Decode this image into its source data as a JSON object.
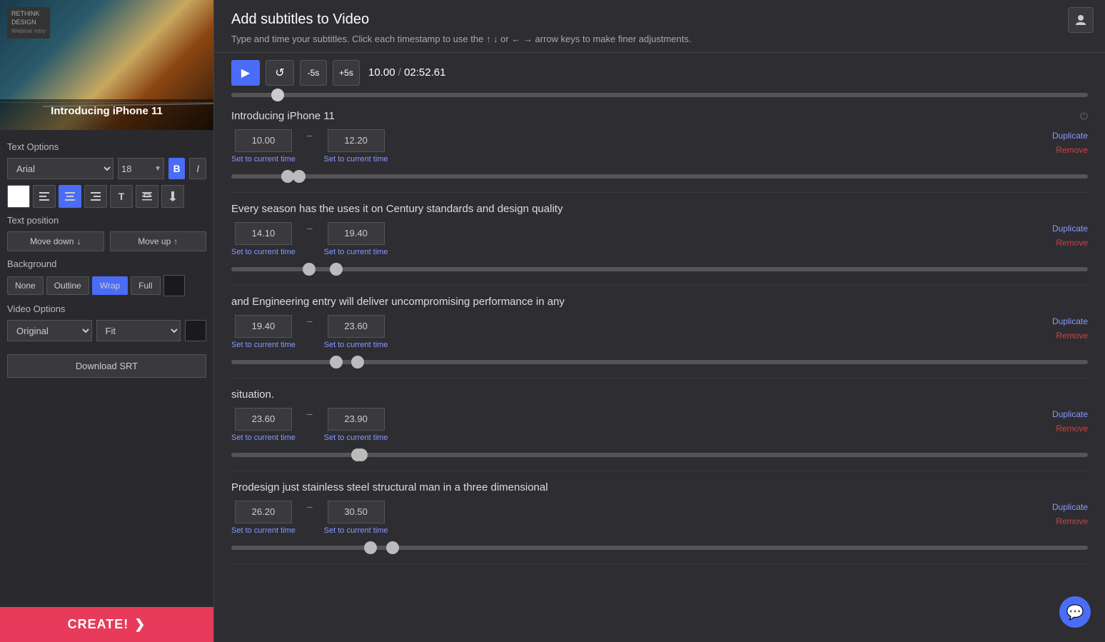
{
  "sidebar": {
    "logo_line1": "RETHINK",
    "logo_line2": "DESIGN",
    "video_title": "Introducing iPhone 11",
    "text_options_label": "Text Options",
    "font": "Arial",
    "font_size": "18",
    "bold_label": "B",
    "italic_label": "I",
    "align_buttons": [
      {
        "icon": "⬛",
        "label": "color-swatch"
      },
      {
        "icon": "≡",
        "label": "align-left"
      },
      {
        "icon": "≡",
        "label": "align-center",
        "active": true
      },
      {
        "icon": "≡",
        "label": "align-right"
      },
      {
        "icon": "T",
        "label": "text-style"
      },
      {
        "icon": "÷",
        "label": "distribute"
      },
      {
        "icon": "↓",
        "label": "align-bottom"
      }
    ],
    "text_position_label": "Text position",
    "move_down_label": "Move down",
    "move_up_label": "Move up",
    "background_label": "Background",
    "bg_buttons": [
      "None",
      "Outline",
      "Wrap",
      "Full"
    ],
    "bg_active": "Wrap",
    "video_options_label": "Video Options",
    "video_ratio": "Original",
    "video_fit": "Fit",
    "download_srt_label": "Download SRT",
    "create_label": "CREATE!"
  },
  "main": {
    "title": "Add subtitles to Video",
    "subtitle_hint": "Type and time your subtitles. Click each timestamp to use the ↑ ↓ or ← → arrow keys to make finer adjustments.",
    "current_time": "10.00",
    "total_time": "02:52.61",
    "transport_buttons": {
      "play": "▶",
      "rewind": "↺",
      "minus5": "-5s",
      "plus5": "+5s"
    },
    "subtitles": [
      {
        "id": 1,
        "text": "Introducing iPhone 11",
        "start": "10.00",
        "end": "12.20",
        "set_time_start": "Set to current time",
        "set_time_end": "Set to current time",
        "slider_start_pct": 5.8,
        "slider_end_pct": 7.2
      },
      {
        "id": 2,
        "text": "Every season has the uses it on Century standards and design quality",
        "start": "14.10",
        "end": "19.40",
        "set_time_start": "Set to current time",
        "set_time_end": "Set to current time",
        "slider_start_pct": 8.3,
        "slider_end_pct": 11.5
      },
      {
        "id": 3,
        "text": "and Engineering entry will deliver uncompromising performance in any",
        "start": "19.40",
        "end": "23.60",
        "set_time_start": "Set to current time",
        "set_time_end": "Set to current time",
        "slider_start_pct": 11.5,
        "slider_end_pct": 14.0
      },
      {
        "id": 4,
        "text": "situation.",
        "start": "23.60",
        "end": "23.90",
        "set_time_start": "Set to current time",
        "set_time_end": "Set to current time",
        "slider_start_pct": 14.0,
        "slider_end_pct": 14.2
      },
      {
        "id": 5,
        "text": "Prodesign just stainless steel structural man in a three dimensional",
        "start": "26.20",
        "end": "30.50",
        "set_time_start": "Set to current time",
        "set_time_end": "Set to current time",
        "slider_start_pct": 15.5,
        "slider_end_pct": 18.1
      }
    ],
    "duplicate_label": "Duplicate",
    "remove_label": "Remove"
  }
}
